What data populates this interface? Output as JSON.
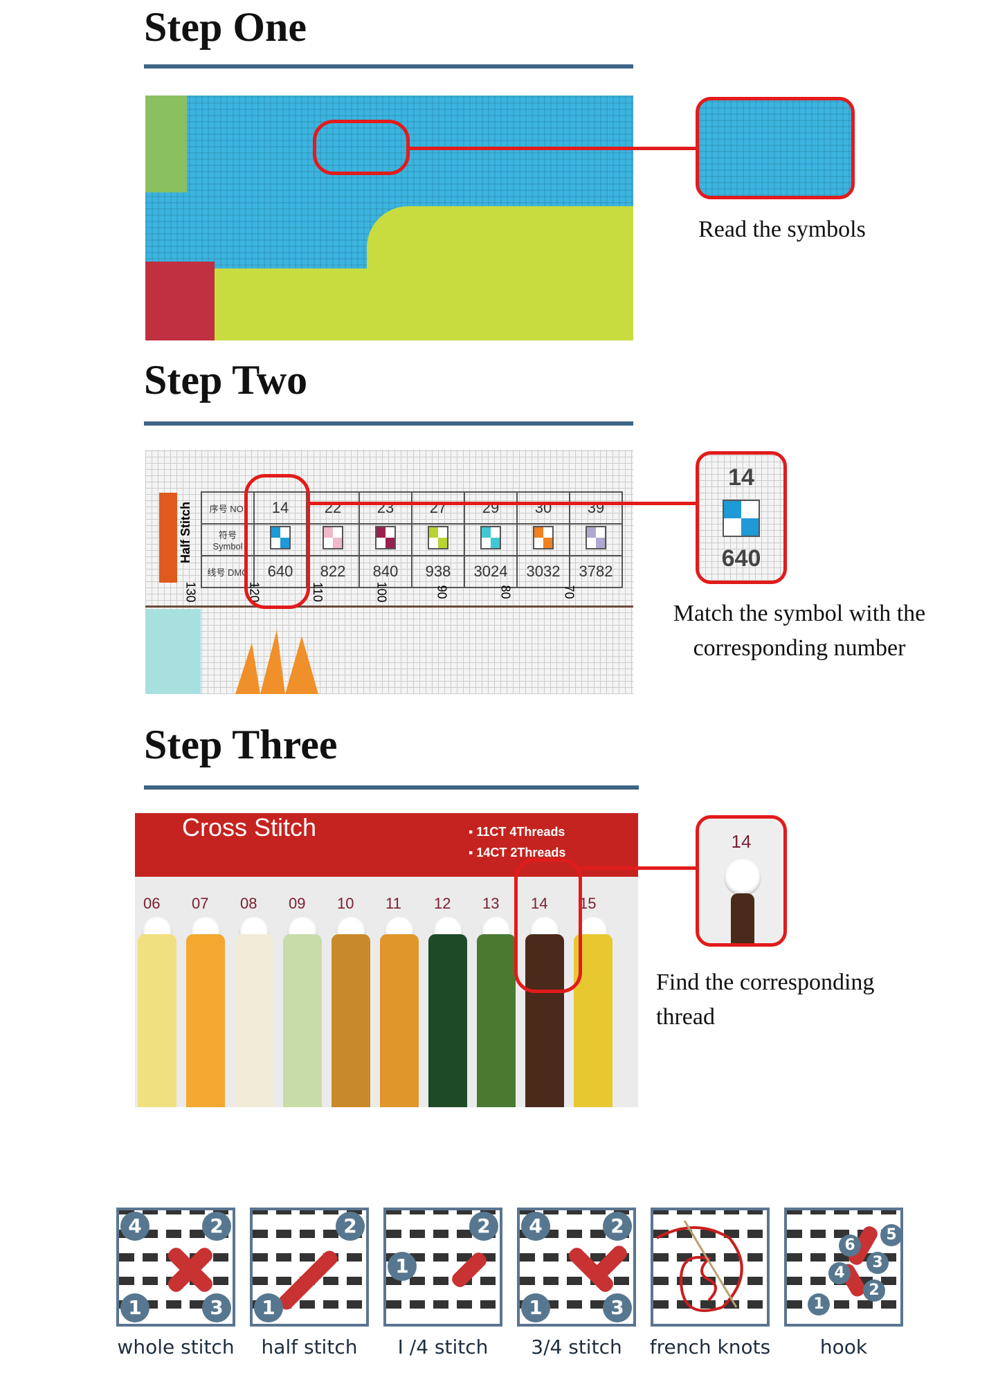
{
  "steps": [
    {
      "title": "Step One",
      "caption": "Read the symbols"
    },
    {
      "title": "Step Two",
      "caption_line1": "Match the symbol with the",
      "caption_line2": "corresponding number"
    },
    {
      "title": "Step Three",
      "caption_line1": "Find the corresponding",
      "caption_line2": "thread"
    }
  ],
  "chart": {
    "side_label": "Half Stitch",
    "row_labels": [
      "序号 NO.",
      "符号 Symbol",
      "线号 DMC"
    ],
    "numbers": [
      "14",
      "22",
      "23",
      "27",
      "29",
      "30",
      "39"
    ],
    "dmc": [
      "640",
      "822",
      "840",
      "938",
      "3024",
      "3032",
      "3782"
    ],
    "symbol_colors": [
      "#1e9ad6",
      "#f0b8c8",
      "#9a2050",
      "#b8d430",
      "#40c8d0",
      "#f08020",
      "#b0a8d0"
    ],
    "ruler": [
      "130",
      "120",
      "110",
      "100",
      "90",
      "80",
      "70"
    ],
    "callout_number": "14",
    "callout_dmc": "640"
  },
  "card": {
    "title": "Cross Stitch",
    "options": [
      "11CT 4Threads",
      "14CT 2Threads"
    ],
    "numbers": [
      "06",
      "07",
      "08",
      "09",
      "10",
      "11",
      "12",
      "13",
      "14",
      "15"
    ],
    "thread_colors": [
      "#f0e080",
      "#f4a830",
      "#f0ecd8",
      "#c8dca8",
      "#c88a28",
      "#e0962a",
      "#1e4a28",
      "#4a7a30",
      "#4a2a1a",
      "#e8c830"
    ],
    "callout_number": "14"
  },
  "stitches": [
    {
      "label": "whole stitch",
      "nums": [
        "4",
        "2",
        "1",
        "3"
      ]
    },
    {
      "label": "half stitch",
      "nums": [
        "2",
        "1"
      ]
    },
    {
      "label": "I /4 stitch",
      "nums": [
        "2",
        "1"
      ]
    },
    {
      "label": "3/4 stitch",
      "nums": [
        "4",
        "2",
        "1",
        "3"
      ]
    },
    {
      "label": "french knots",
      "nums": []
    },
    {
      "label": "hook",
      "nums": [
        "5",
        "6",
        "3",
        "4",
        "2",
        "1"
      ]
    }
  ],
  "colors": {
    "accent_red": "#e21b1b",
    "rule_blue": "#3d6486",
    "card_red": "#c5231f"
  }
}
